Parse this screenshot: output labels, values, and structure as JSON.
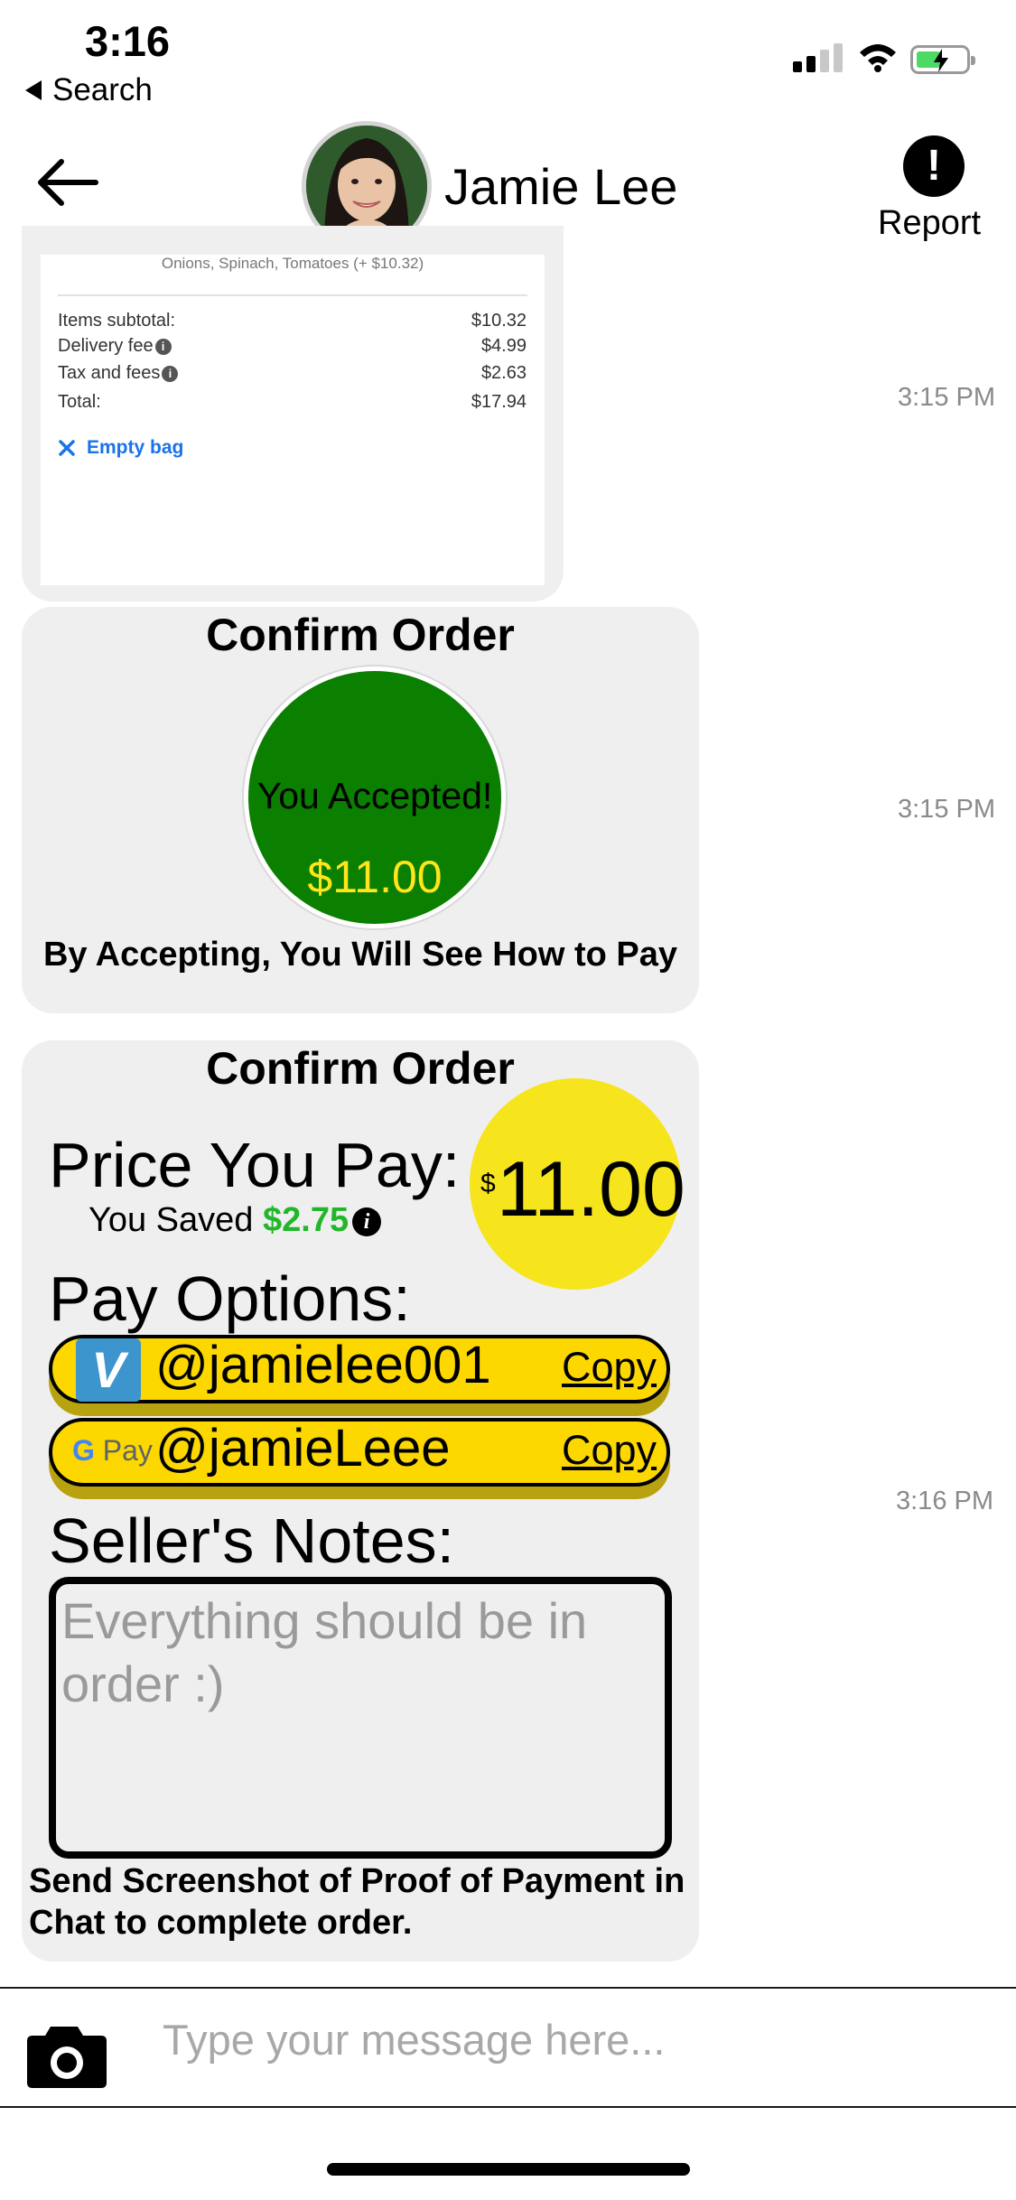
{
  "status_bar": {
    "time": "3:16",
    "back_app": "Search",
    "icons": [
      "signal-icon",
      "wifi-icon",
      "battery-charging-icon"
    ]
  },
  "header": {
    "contact_name": "Jamie Lee",
    "report_label": "Report",
    "icons": [
      "back-arrow-icon",
      "alert-icon"
    ]
  },
  "receipt": {
    "note": "Onions, Spinach, Tomatoes (+ $10.32)",
    "rows": [
      {
        "label": "Items subtotal:",
        "value": "$10.32",
        "info": false
      },
      {
        "label": "Delivery fee",
        "value": "$4.99",
        "info": true
      },
      {
        "label": "Tax and fees",
        "value": "$2.63",
        "info": true
      },
      {
        "label": "Total:",
        "value": "$17.94",
        "info": false
      }
    ],
    "empty_bag": "Empty bag",
    "timestamp": "3:15 PM"
  },
  "accepted": {
    "title": "Confirm Order",
    "status": "You Accepted!",
    "price": "$11.00",
    "note": "By Accepting, You Will See How to Pay",
    "timestamp": "3:15 PM"
  },
  "payment": {
    "title": "Confirm Order",
    "price_label": "Price You Pay:",
    "saved_label": "You Saved",
    "saved_amount": "$2.75",
    "currency": "$",
    "price": "11.00",
    "pay_options_label": "Pay Options:",
    "options": [
      {
        "service": "venmo",
        "logo_text": "V",
        "handle": "@jamielee001",
        "copy": "Copy"
      },
      {
        "service": "google-pay",
        "logo_text": "Pay",
        "handle": "@jamieLeee",
        "copy": "Copy"
      }
    ],
    "notes_label": "Seller's Notes:",
    "notes_text": "Everything should be in order :)",
    "send_note": "Send Screenshot of Proof of Payment in Chat to complete order.",
    "timestamp": "3:16 PM"
  },
  "composer": {
    "placeholder": "Type your message here..."
  },
  "colors": {
    "accepted_green": "#0a7f00",
    "price_yellow": "#f6e41c",
    "pill_yellow": "#fcd700",
    "saved_green": "#22b72a",
    "link_blue": "#1a73e8",
    "bubble_gray": "#efefef",
    "venmo_blue": "#3d95ce"
  }
}
